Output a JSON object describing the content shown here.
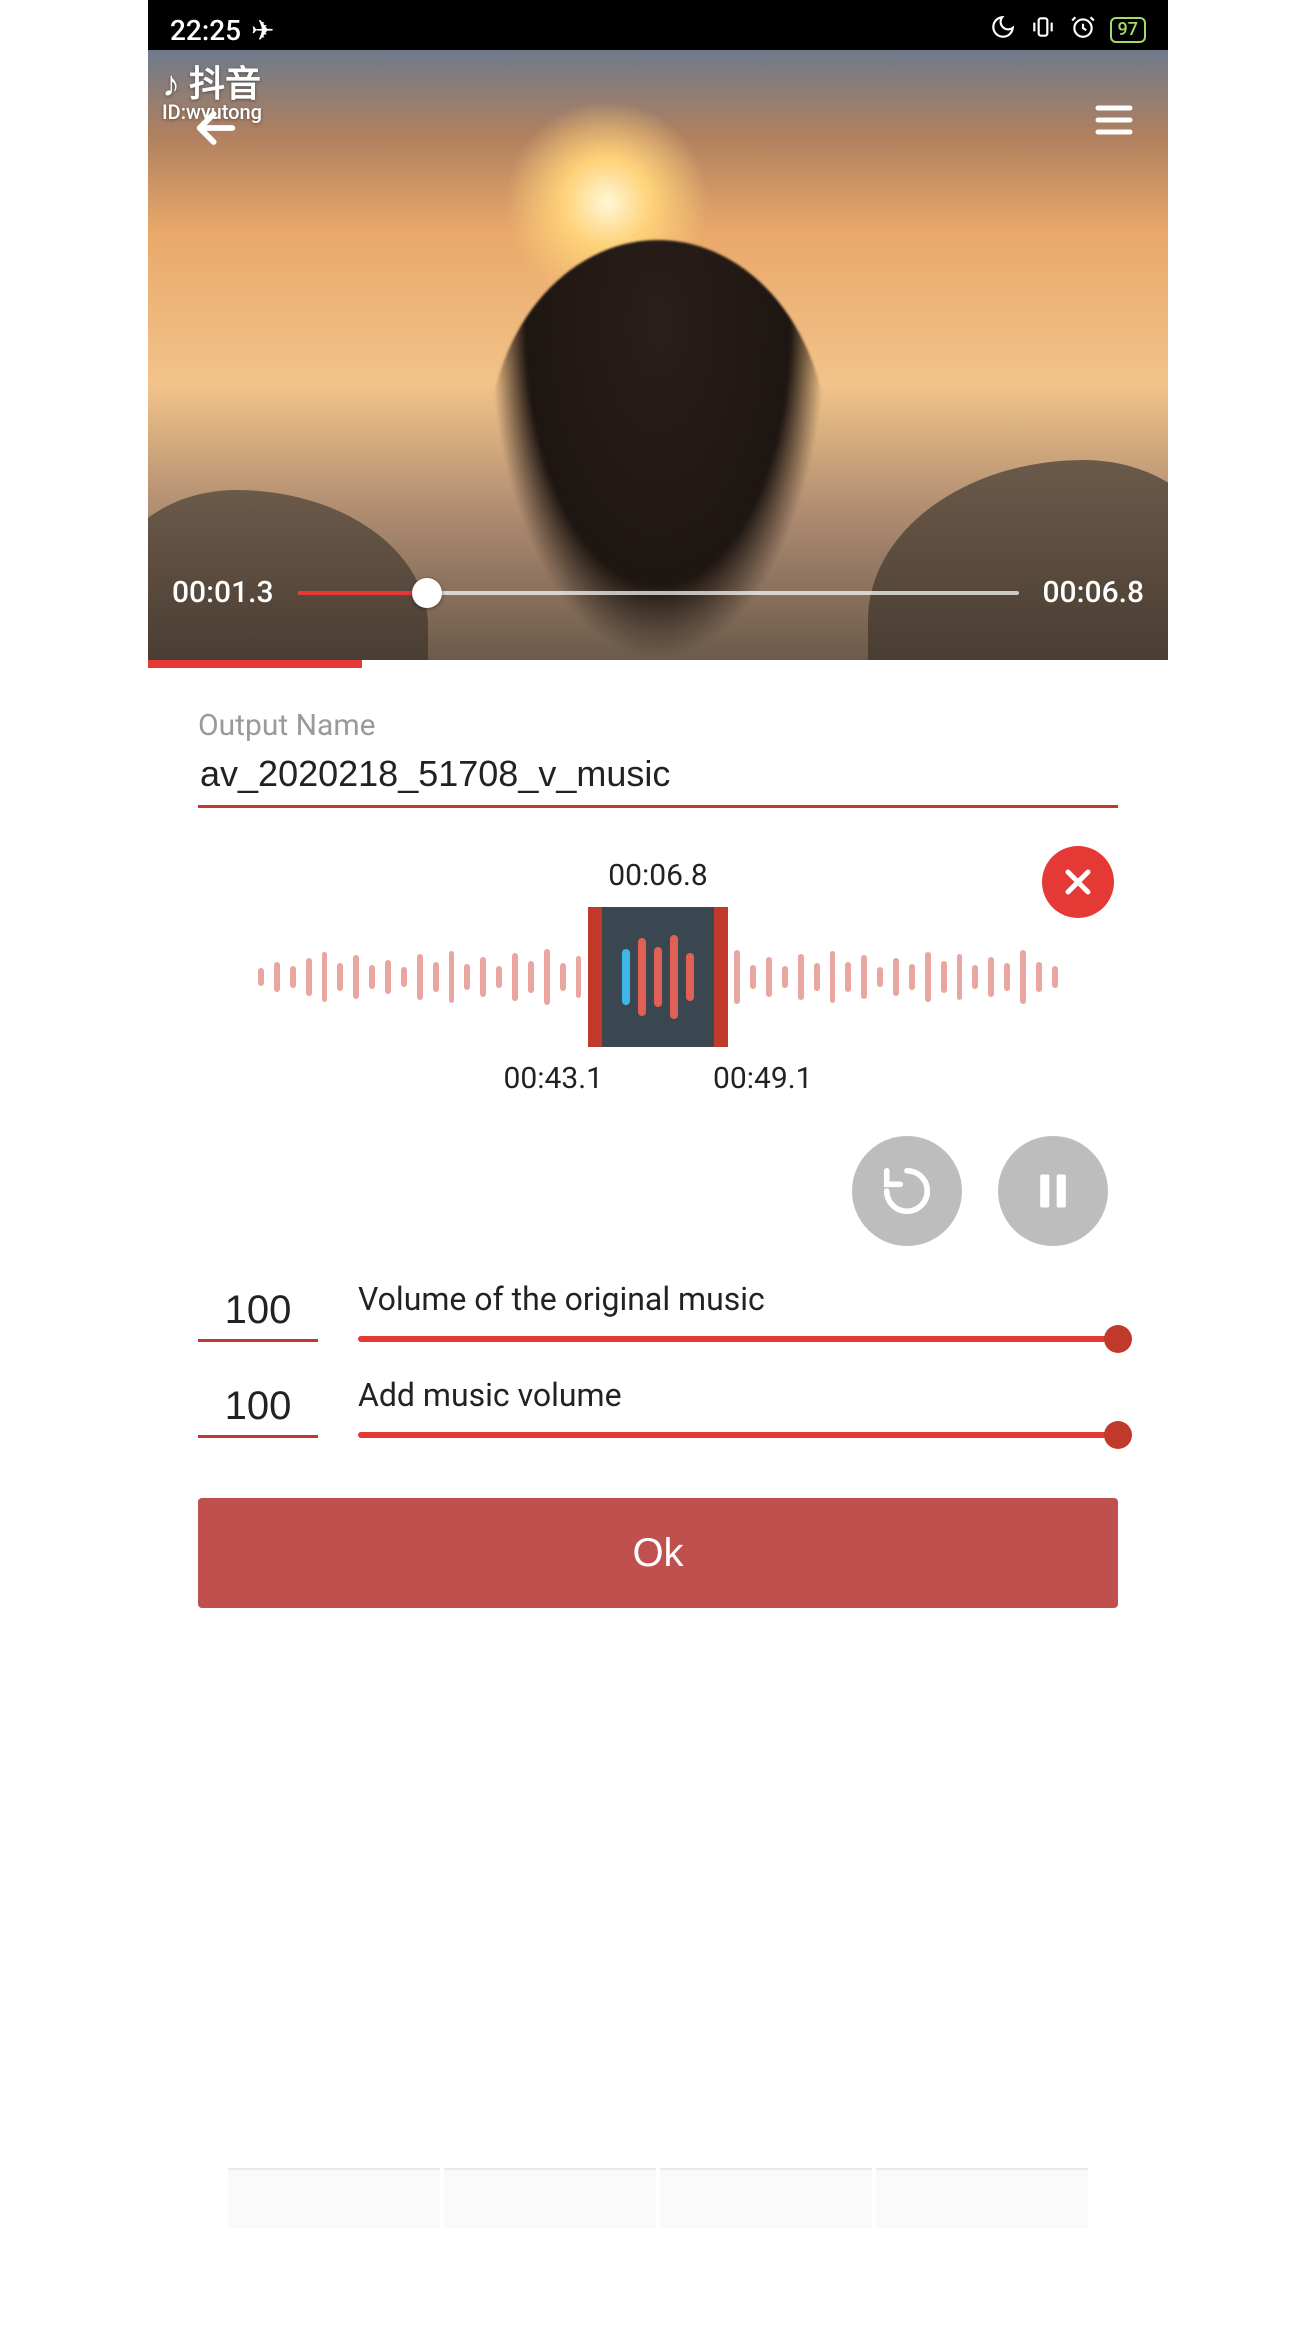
{
  "status": {
    "time": "22:25",
    "airplane": "✈",
    "battery": "97"
  },
  "watermark": {
    "logo": "抖音",
    "id_line": "ID:wyutong"
  },
  "video": {
    "current_time": "00:01.3",
    "total_time": "00:06.8",
    "progress_pct": 18
  },
  "output": {
    "label": "Output Name",
    "value": "av_2020218_51708_v_music"
  },
  "audio_clip": {
    "video_length": "00:06.8",
    "start_time": "00:43.1",
    "end_time": "00:49.1"
  },
  "volumes": {
    "original": {
      "label": "Volume of the original music",
      "value": "100",
      "pct": 100
    },
    "added": {
      "label": "Add music volume",
      "value": "100",
      "pct": 100
    }
  },
  "ok_label": "Ok"
}
